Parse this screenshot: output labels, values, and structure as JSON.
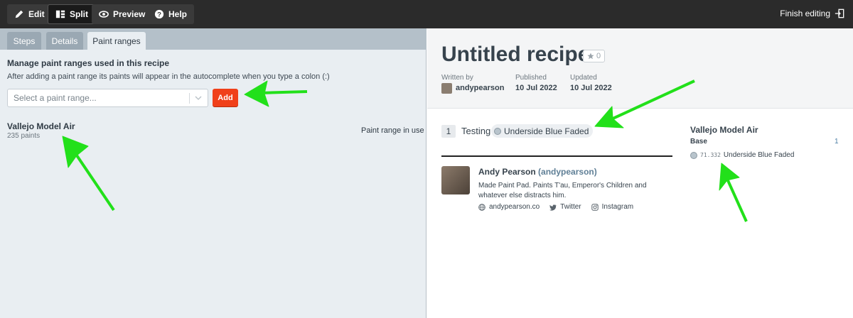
{
  "toolbar": {
    "edit_label": "Edit",
    "split_label": "Split",
    "preview_label": "Preview",
    "help_label": "Help",
    "finish_label": "Finish editing"
  },
  "tabs": [
    {
      "label": "Steps"
    },
    {
      "label": "Details"
    },
    {
      "label": "Paint ranges"
    }
  ],
  "paint_ranges": {
    "title": "Manage paint ranges used in this recipe",
    "description": "After adding a paint range its paints will appear in the autocomplete when you type a colon (:)",
    "select_placeholder": "Select a paint range...",
    "add_label": "Add",
    "range": {
      "name": "Vallejo Model Air",
      "count": "235 paints",
      "status": "Paint range in use"
    }
  },
  "recipe": {
    "title": "Untitled recipe",
    "stars": "0",
    "written_by_label": "Written by",
    "author": "andypearson",
    "published_label": "Published",
    "published": "10 Jul 2022",
    "updated_label": "Updated",
    "updated": "10 Jul 2022",
    "step": {
      "number": "1",
      "text": "Testing",
      "paint": "Underside Blue Faded"
    },
    "author_card": {
      "name": "Andy Pearson",
      "handle": "(andypearson)",
      "bio": "Made Paint Pad. Paints T'au, Emperor's Children and whatever else distracts him.",
      "website": "andypearson.co",
      "twitter": "Twitter",
      "instagram": "Instagram"
    },
    "paint_list": {
      "range": "Vallejo Model Air",
      "group": "Base",
      "group_count": "1",
      "paint_code": "71.332",
      "paint_name": "Underside Blue Faded"
    }
  },
  "colors": {
    "accent": "#f0401a",
    "annotation_arrow": "#22e01a",
    "toolbar_bg": "#2b2b2b"
  }
}
